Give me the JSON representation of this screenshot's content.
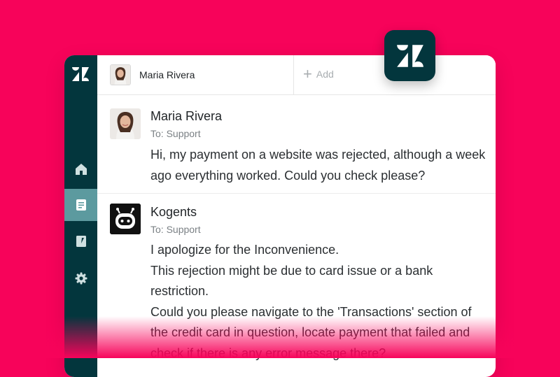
{
  "colors": {
    "background": "#f7035a",
    "sidebar": "#03363d",
    "sidebar_active": "#5c9a9f",
    "badge": "#03363d"
  },
  "brand": {
    "logo_icon": "zendesk-logo-icon"
  },
  "sidebar": {
    "items": [
      {
        "icon": "home-icon",
        "active": false
      },
      {
        "icon": "tickets-icon",
        "active": true
      },
      {
        "icon": "knowledge-icon",
        "active": false
      },
      {
        "icon": "gear-icon",
        "active": false
      }
    ]
  },
  "tabs": {
    "active": {
      "name": "Maria Rivera",
      "avatar_icon": "user-avatar"
    },
    "add_label": "Add"
  },
  "conversation": [
    {
      "author": "Maria Rivera",
      "to": "To: Support",
      "avatar_icon": "user-avatar",
      "lines": [
        "Hi, my payment on a website was rejected, although a week",
        "ago everything worked. Could you check please?"
      ]
    },
    {
      "author": "Kogents",
      "to": "To: Support",
      "avatar_icon": "bot-avatar",
      "lines": [
        "I apologize for the Inconvenience.",
        "This rejection might be due to card issue or a bank",
        "restriction.",
        "Could you please navigate to the 'Transactions'  section of",
        "the credit card in question, locate payment that failed and",
        "check if there is any error message there?"
      ]
    }
  ]
}
